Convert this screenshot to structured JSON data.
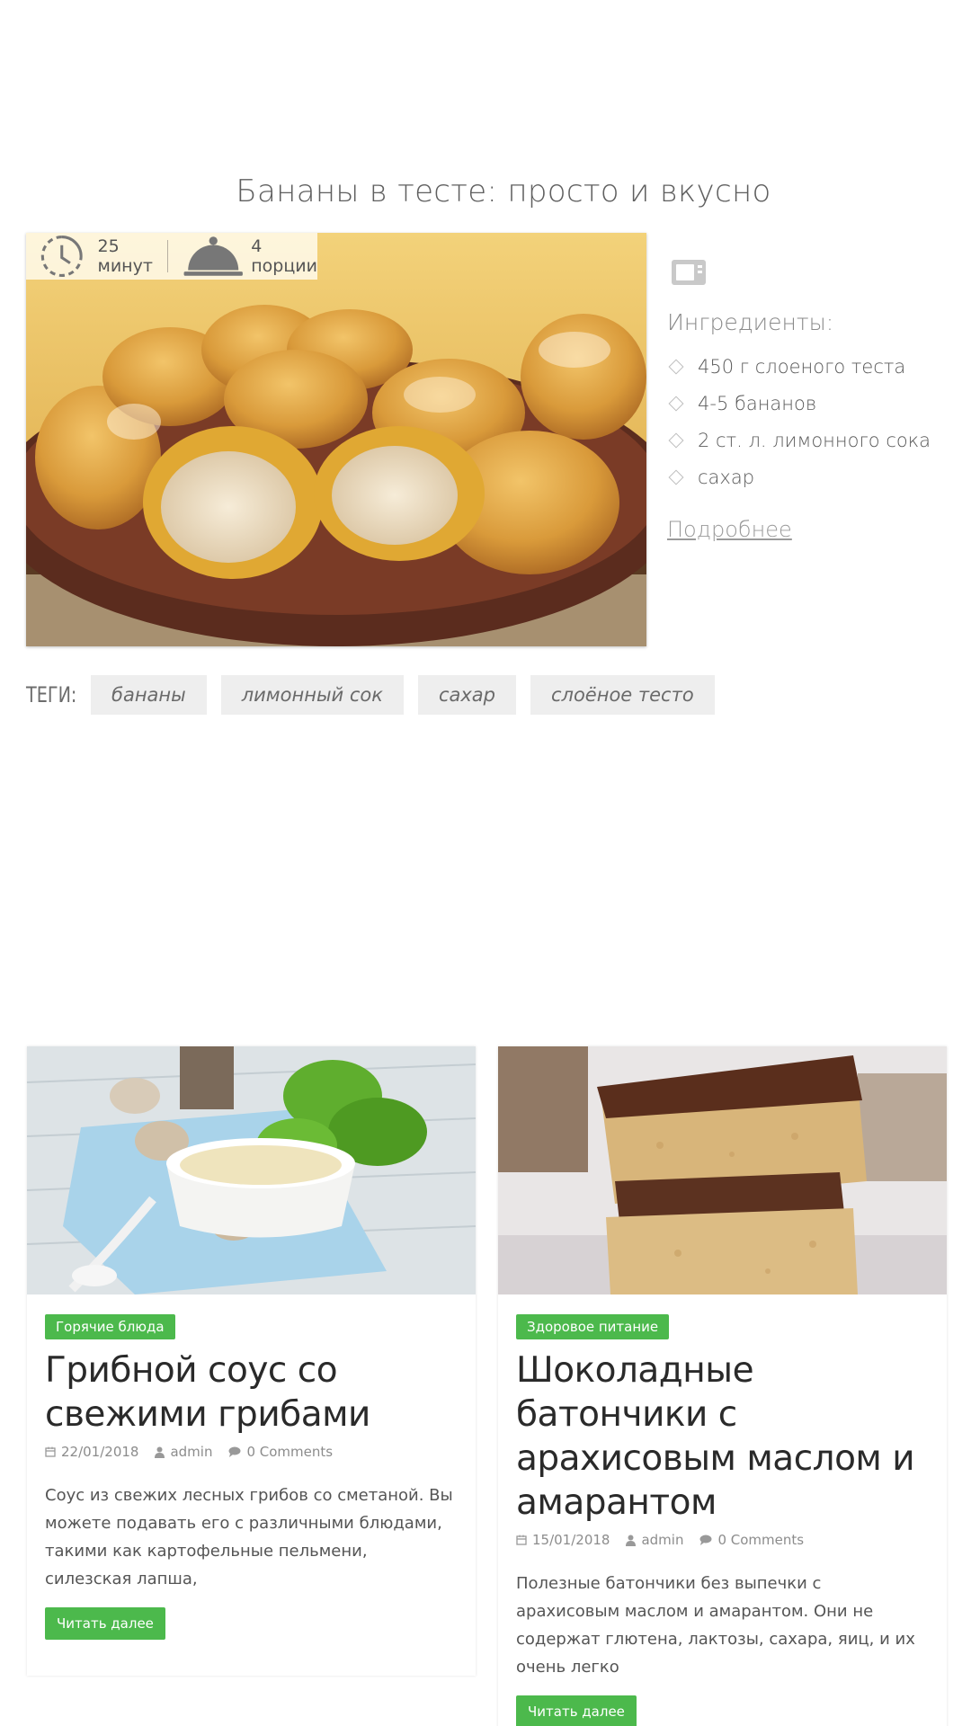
{
  "recipe": {
    "title": "Бананы в тесте: просто и вкусно",
    "time": "25 минут",
    "servings": "4 порции",
    "ingredients_heading": "Ингредиенты:",
    "ingredients": [
      "450 г слоеного теста",
      "4-5 бананов",
      "2 ст. л. лимонного сока",
      "сахар"
    ],
    "more_link": "Подробнее",
    "tags_label": "ТЕГИ:",
    "tags": [
      "бананы",
      "лимонный сок",
      "сахар",
      "слоёное тесто"
    ]
  },
  "posts": [
    {
      "category": "Горячие блюда",
      "title": "Грибной соус со свежими грибами",
      "date": "22/01/2018",
      "author": "admin",
      "comments": "0 Comments",
      "excerpt": "Соус из свежих лесных грибов со сметаной. Вы можете подавать его с различными блюдами, такими как картофельные пельмени, силезская лапша,",
      "read_more": "Читать далее"
    },
    {
      "category": "Здоровое питание",
      "title": "Шоколадные батончики с арахисовым маслом и амарантом",
      "date": "15/01/2018",
      "author": "admin",
      "comments": "0 Comments",
      "excerpt": "Полезные батончики без выпечки с арахисовым маслом и амарантом. Они не содержат глютена, лактозы, сахара, яиц, и их очень легко",
      "read_more": "Читать далее"
    }
  ],
  "colors": {
    "accent_green": "#4cb94c",
    "tag_bg": "#eeeeee"
  },
  "icons": [
    "clock-icon",
    "cloche-icon",
    "microwave-icon",
    "diamond-bullet-icon",
    "calendar-icon",
    "user-icon",
    "comment-icon"
  ]
}
